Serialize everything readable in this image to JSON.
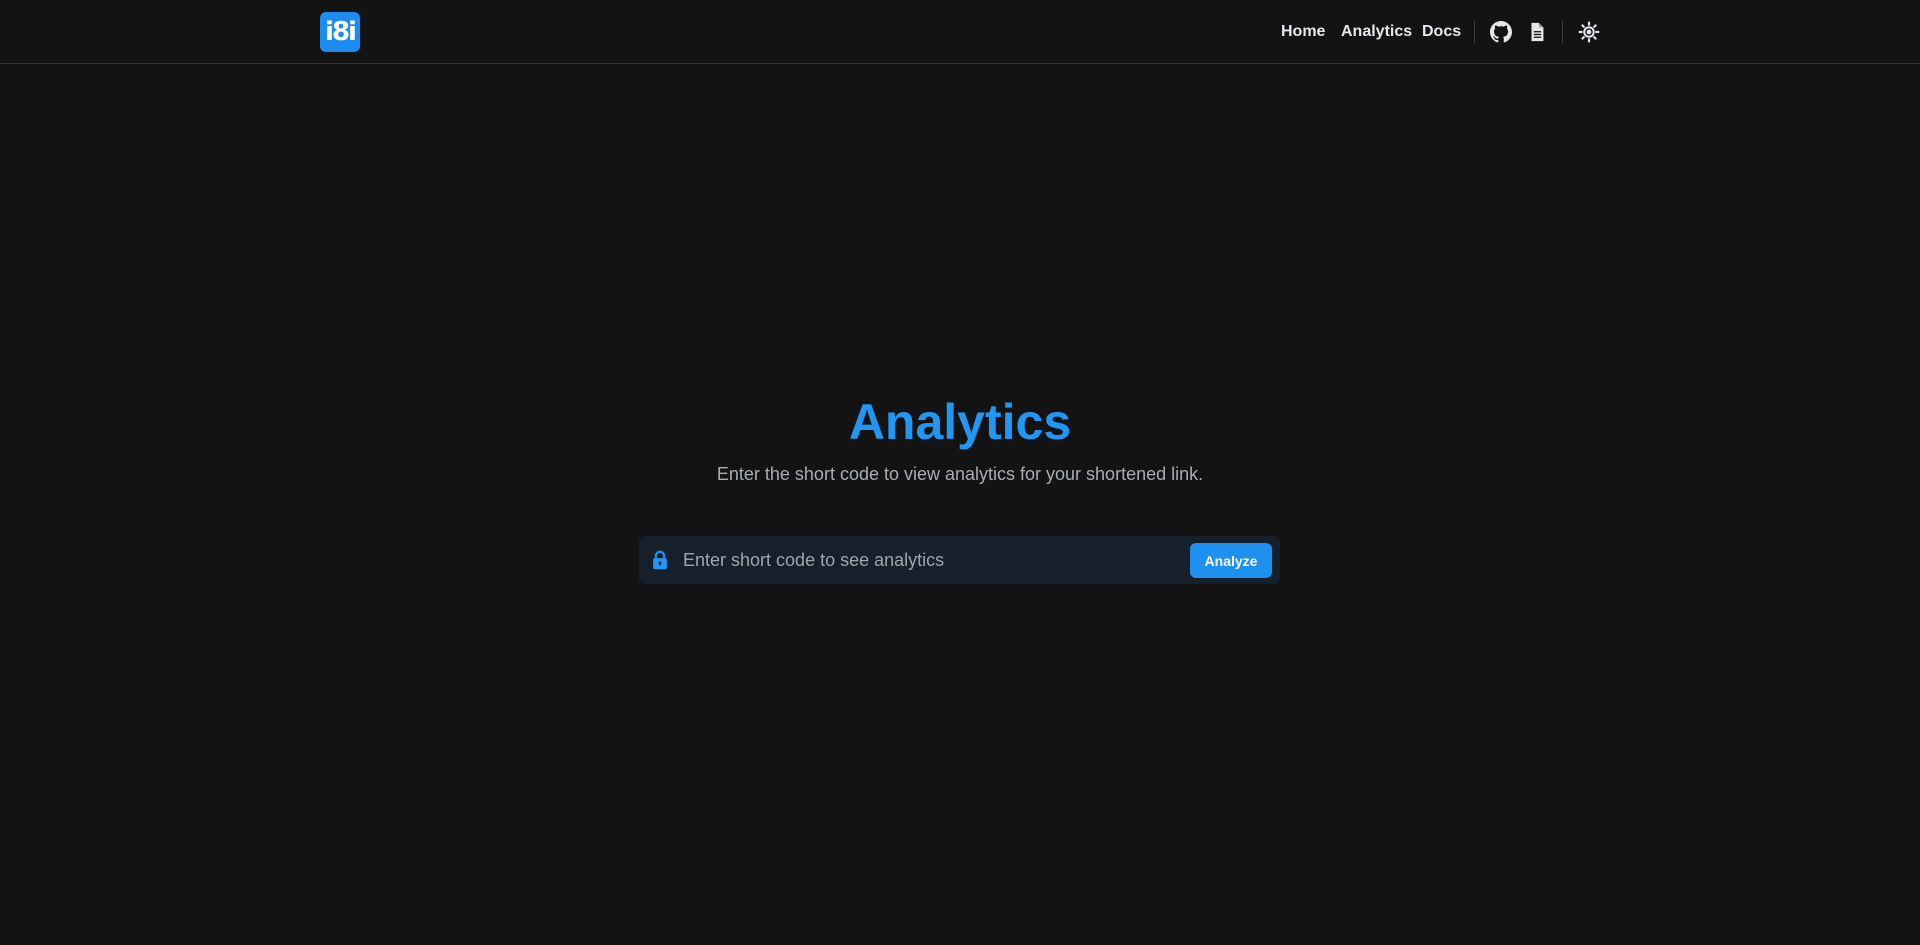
{
  "header": {
    "logo_text": "i8i",
    "nav": [
      {
        "label": "Home"
      },
      {
        "label": "Analytics"
      },
      {
        "label": "Docs"
      }
    ],
    "icons": [
      "github-icon",
      "document-icon",
      "sun-icon"
    ]
  },
  "main": {
    "title": "Analytics",
    "subtitle": "Enter the short code to view analytics for your shortened link.",
    "search": {
      "placeholder": "Enter short code to see analytics",
      "value": "",
      "button_label": "Analyze",
      "icon": "lock-icon"
    }
  },
  "colors": {
    "background": "#131313",
    "accent": "#2196f3",
    "input_background": "#15202b"
  }
}
